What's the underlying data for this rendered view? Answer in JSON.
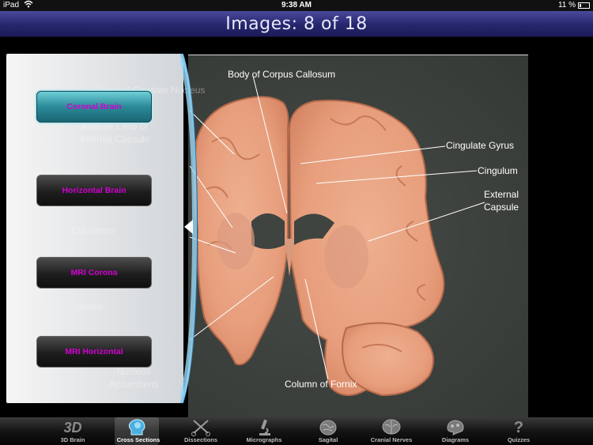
{
  "status_bar": {
    "device": "iPad",
    "time": "9:38 AM",
    "battery": "11 %"
  },
  "title": "Images: 8 of 18",
  "image_labels": [
    {
      "key": "body_corpus",
      "text": "Body of Corpus Callosum"
    },
    {
      "key": "cingulate_gyrus",
      "text": "Cingulate Gyrus"
    },
    {
      "key": "cingulum",
      "text": "Cingulum"
    },
    {
      "key": "external_capsule",
      "text": "External\nCapsule"
    },
    {
      "key": "column_fornix",
      "text": "Column of Fornix"
    }
  ],
  "covered_labels": [
    {
      "key": "caudate",
      "text": "Head of Caudate Nucleus"
    },
    {
      "key": "internal_capsule",
      "text": "Anterior Limb of\nInternal Capsule"
    },
    {
      "key": "claustrum",
      "text": "Claustrum"
    },
    {
      "key": "insula",
      "text": "Insula"
    },
    {
      "key": "accumbens",
      "text": "Nucleus\nAccumbens"
    }
  ],
  "panel": {
    "buttons": [
      {
        "label": "Coronal Brain",
        "active": true
      },
      {
        "label": "Horizontal Brain",
        "active": false
      },
      {
        "label": "MRI Corona",
        "active": false
      },
      {
        "label": "MRI Horizontal",
        "active": false
      }
    ]
  },
  "tabs": [
    {
      "label": "3D Brain",
      "icon": "3d-icon",
      "active": false
    },
    {
      "label": "Cross Sections",
      "icon": "head-icon",
      "active": true
    },
    {
      "label": "Dissections",
      "icon": "scissors-icon",
      "active": false
    },
    {
      "label": "Micrographs",
      "icon": "microscope-icon",
      "active": false
    },
    {
      "label": "Sagital",
      "icon": "brain-side-icon",
      "active": false
    },
    {
      "label": "Cranial Nerves",
      "icon": "brain-bottom-icon",
      "active": false
    },
    {
      "label": "Diagrams",
      "icon": "brain-diagram-icon",
      "active": false
    },
    {
      "label": "Quizzes",
      "icon": "question-icon",
      "active": false
    }
  ],
  "colors": {
    "title_bar": "#26266e",
    "panel_button_text": "#d200d2",
    "active_button": "#2b8a98",
    "tissue": "#e8a080"
  }
}
